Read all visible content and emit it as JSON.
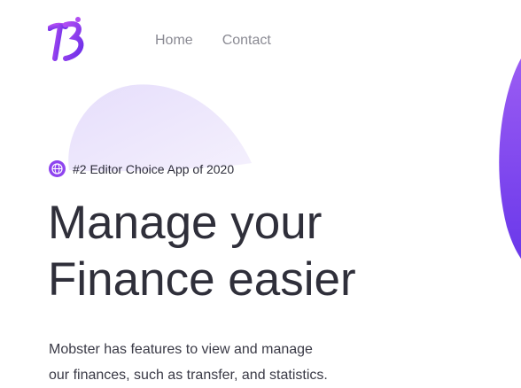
{
  "nav": {
    "items": [
      {
        "label": "Home"
      },
      {
        "label": "Contact"
      }
    ]
  },
  "hero": {
    "badge_text": "#2 Editor Choice App of 2020",
    "headline_lines": [
      "Manage your",
      "Finance easier"
    ],
    "description_lines": [
      "Mobster has features to view and manage",
      "our finances, such as transfer, and statistics."
    ]
  },
  "colors": {
    "brand_purple": "#8e44ef",
    "blob_lavender": "#ece6fc",
    "heading_text": "#2f2f3a",
    "nav_text": "#8a8a93"
  },
  "icons": {
    "logo": "brand-logo-icon",
    "badge": "globe-icon"
  }
}
